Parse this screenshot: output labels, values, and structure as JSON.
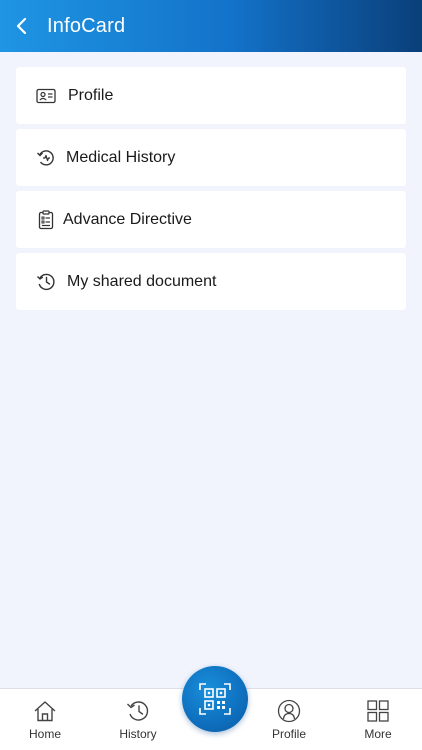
{
  "header": {
    "back_icon": "chevron-left-icon",
    "title": "InfoCard"
  },
  "menu": {
    "items": [
      {
        "label": "Profile",
        "icon": "id-card-icon"
      },
      {
        "label": "Medical History",
        "icon": "medical-history-icon"
      },
      {
        "label": "Advance Directive",
        "icon": "checklist-clipboard-icon"
      },
      {
        "label": "My shared document",
        "icon": "clock-history-icon"
      }
    ]
  },
  "tabbar": {
    "tabs": [
      {
        "label": "Home",
        "icon": "home-icon"
      },
      {
        "label": "History",
        "icon": "history-icon"
      },
      {
        "label": "Profile",
        "icon": "user-profile-icon"
      },
      {
        "label": "More",
        "icon": "grid-icon"
      }
    ],
    "center_button_icon": "qr-code-icon"
  },
  "colors": {
    "header_start": "#1f95e3",
    "header_end": "#0a3f7a",
    "background": "#f1f4fd",
    "accent": "#0e6fbe"
  }
}
